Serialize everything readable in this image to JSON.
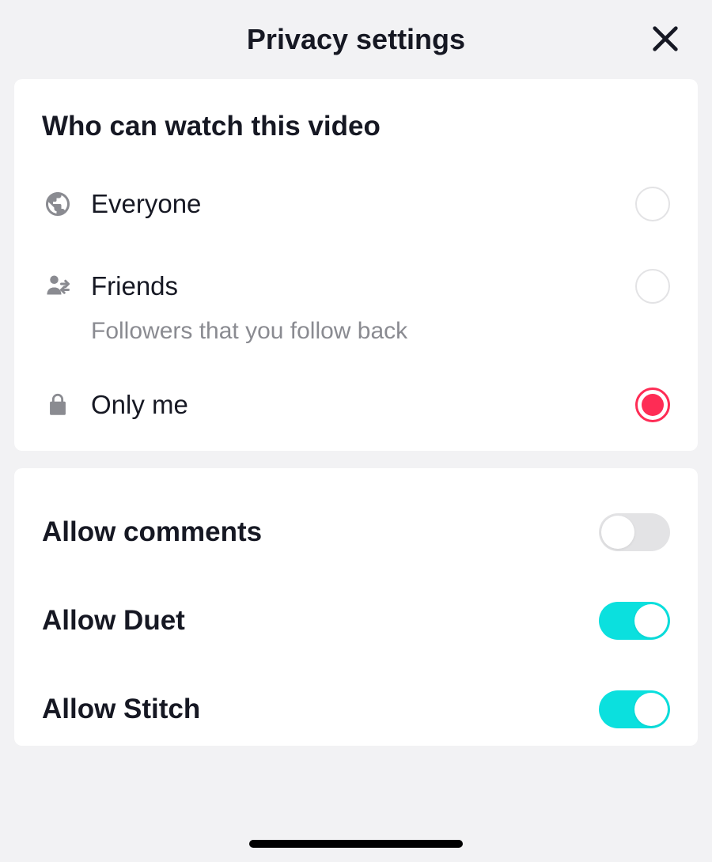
{
  "header": {
    "title": "Privacy settings"
  },
  "audience": {
    "section_title": "Who can watch this video",
    "options": [
      {
        "label": "Everyone",
        "sub": "",
        "selected": false
      },
      {
        "label": "Friends",
        "sub": "Followers that you follow back",
        "selected": false
      },
      {
        "label": "Only me",
        "sub": "",
        "selected": true
      }
    ]
  },
  "toggles": [
    {
      "label": "Allow comments",
      "on": false
    },
    {
      "label": "Allow Duet",
      "on": true
    },
    {
      "label": "Allow Stitch",
      "on": true
    }
  ],
  "colors": {
    "accent_red": "#fe2c55",
    "accent_teal": "#0be0de",
    "text": "#161823",
    "muted": "#8a8b91",
    "bg": "#f2f2f4"
  }
}
